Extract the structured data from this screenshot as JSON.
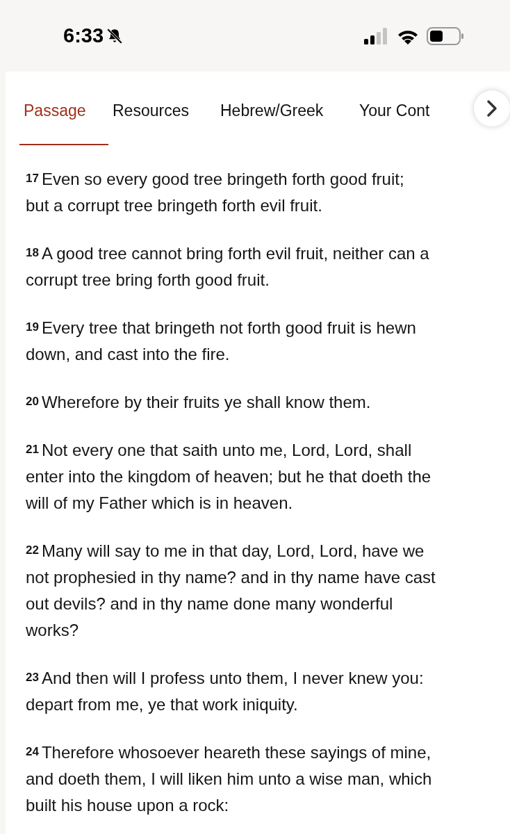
{
  "status_bar": {
    "time": "6:33"
  },
  "tabs": [
    {
      "label": "Passage",
      "selected": true
    },
    {
      "label": "Resources",
      "selected": false
    },
    {
      "label": "Hebrew/Greek",
      "selected": false
    },
    {
      "label": "Your Cont",
      "selected": false
    }
  ],
  "verses": [
    {
      "number": "17",
      "lines": [
        "Even so every good tree bringeth forth good fruit;",
        "but a corrupt tree bringeth forth evil fruit."
      ]
    },
    {
      "number": "18",
      "lines": [
        "A good tree cannot bring forth evil fruit, neither can a",
        "corrupt tree bring forth good fruit."
      ]
    },
    {
      "number": "19",
      "lines": [
        "Every tree that bringeth not forth good fruit is hewn",
        "down, and cast into the fire."
      ]
    },
    {
      "number": "20",
      "lines": [
        "Wherefore by their fruits ye shall know them."
      ]
    },
    {
      "number": "21",
      "lines": [
        "Not every one that saith unto me, Lord, Lord, shall",
        "enter into the kingdom of heaven; but he that doeth the",
        "will of my Father which is in heaven."
      ]
    },
    {
      "number": "22",
      "lines": [
        "Many will say to me in that day, Lord, Lord, have we",
        "not prophesied in thy name? and in thy name have cast",
        "out devils? and in thy name done many wonderful",
        "works?"
      ]
    },
    {
      "number": "23",
      "lines": [
        "And then will I profess unto them, I never knew you:",
        "depart from me, ye that work iniquity."
      ]
    },
    {
      "number": "24",
      "lines": [
        "Therefore whosoever heareth these sayings of mine,",
        "and doeth them, I will liken him unto a wise man, which",
        "built his house upon a rock:"
      ]
    }
  ]
}
